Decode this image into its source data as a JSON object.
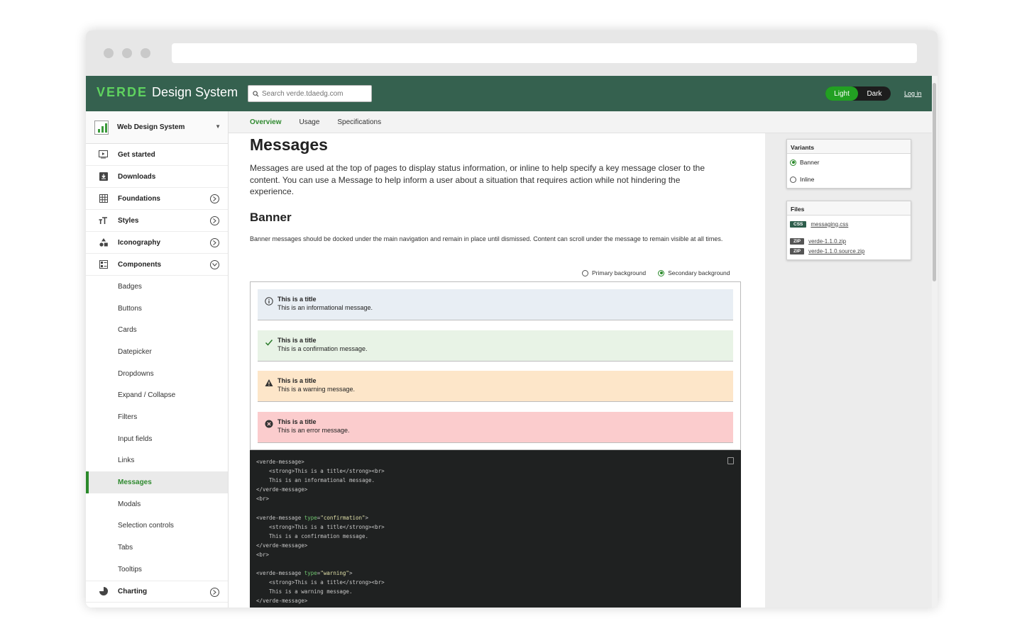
{
  "brand": {
    "logo": "VERDE",
    "title": "Design System"
  },
  "search": {
    "placeholder": "Search verde.tdaedg.com"
  },
  "theme_toggle": {
    "light": "Light",
    "dark": "Dark",
    "selected": "Light"
  },
  "login": "Log in",
  "sidebar": {
    "header": "Web Design System",
    "sections": [
      {
        "label": "Get started",
        "icon": "play-icon"
      },
      {
        "label": "Downloads",
        "icon": "download-icon"
      },
      {
        "label": "Foundations",
        "icon": "grid-icon"
      },
      {
        "label": "Styles",
        "icon": "text-size-icon"
      },
      {
        "label": "Iconography",
        "icon": "shapes-icon"
      },
      {
        "label": "Components",
        "icon": "components-icon"
      }
    ],
    "components": [
      "Badges",
      "Buttons",
      "Cards",
      "Datepicker",
      "Dropdowns",
      "Expand / Collapse",
      "Filters",
      "Input fields",
      "Links",
      "Messages",
      "Modals",
      "Selection controls",
      "Tabs",
      "Tooltips"
    ],
    "active_component": "Messages",
    "charting": {
      "label": "Charting",
      "icon": "pie-chart-icon"
    }
  },
  "tabs": [
    "Overview",
    "Usage",
    "Specifications"
  ],
  "active_tab": "Overview",
  "main": {
    "title": "Messages",
    "lead": "Messages are used at the top of pages to display status information, or inline to help specify a key message closer to the content. You can use a Message to help inform a user about a situation that requires action while not hindering the experience.",
    "section_title": "Banner",
    "section_desc": "Banner messages should be docked under the main navigation and remain in place until dismissed. Content can scroll under the message to remain visible at all times.",
    "bg_options": [
      "Primary background",
      "Secondary background"
    ],
    "bg_selected": "Secondary background",
    "messages": [
      {
        "type": "info",
        "title": "This is a title",
        "text": "This is an informational message.",
        "bg": "#e8eef4",
        "icon": "info-icon"
      },
      {
        "type": "confirmation",
        "title": "This is a title",
        "text": "This is a confirmation message.",
        "bg": "#e8f3e6",
        "icon": "check-icon"
      },
      {
        "type": "warning",
        "title": "This is a title",
        "text": "This is a warning message.",
        "bg": "#fde6c9",
        "icon": "warning-icon"
      },
      {
        "type": "error",
        "title": "This is a title",
        "text": "This is an error message.",
        "bg": "#fbcccd",
        "icon": "error-icon"
      }
    ],
    "code_lines": [
      [
        [
          "tg",
          "<verde-message>"
        ]
      ],
      [
        [
          "tg",
          "    <strong>This is a title</strong><br>"
        ]
      ],
      [
        [
          "tg",
          "    This is an informational message."
        ]
      ],
      [
        [
          "tg",
          "</verde-message>"
        ]
      ],
      [
        [
          "tg",
          "<br>"
        ]
      ],
      [
        [
          "tg",
          ""
        ]
      ],
      [
        [
          "tg",
          "<verde-message "
        ],
        [
          "at",
          "type"
        ],
        [
          "tg",
          "="
        ],
        [
          "st",
          "\"confirmation\""
        ],
        [
          "tg",
          ">"
        ]
      ],
      [
        [
          "tg",
          "    <strong>This is a title</strong><br>"
        ]
      ],
      [
        [
          "tg",
          "    This is a confirmation message."
        ]
      ],
      [
        [
          "tg",
          "</verde-message>"
        ]
      ],
      [
        [
          "tg",
          "<br>"
        ]
      ],
      [
        [
          "tg",
          ""
        ]
      ],
      [
        [
          "tg",
          "<verde-message "
        ],
        [
          "at",
          "type"
        ],
        [
          "tg",
          "="
        ],
        [
          "st",
          "\"warning\""
        ],
        [
          "tg",
          ">"
        ]
      ],
      [
        [
          "tg",
          "    <strong>This is a title</strong><br>"
        ]
      ],
      [
        [
          "tg",
          "    This is a warning message."
        ]
      ],
      [
        [
          "tg",
          "</verde-message>"
        ]
      ]
    ]
  },
  "variants": {
    "title": "Variants",
    "options": [
      "Banner",
      "Inline"
    ],
    "selected": "Banner"
  },
  "files": {
    "title": "Files",
    "items": [
      {
        "tag": "CSS",
        "name": "messaging.css"
      },
      {
        "tag": "ZIP",
        "name": "verde-1.1.0.zip"
      },
      {
        "tag": "ZIP",
        "name": "verde-1.1.0.source.zip"
      }
    ]
  },
  "colors": {
    "nav": "#35614f",
    "accent": "#2f8a2f",
    "toggle_on": "#22a022"
  }
}
